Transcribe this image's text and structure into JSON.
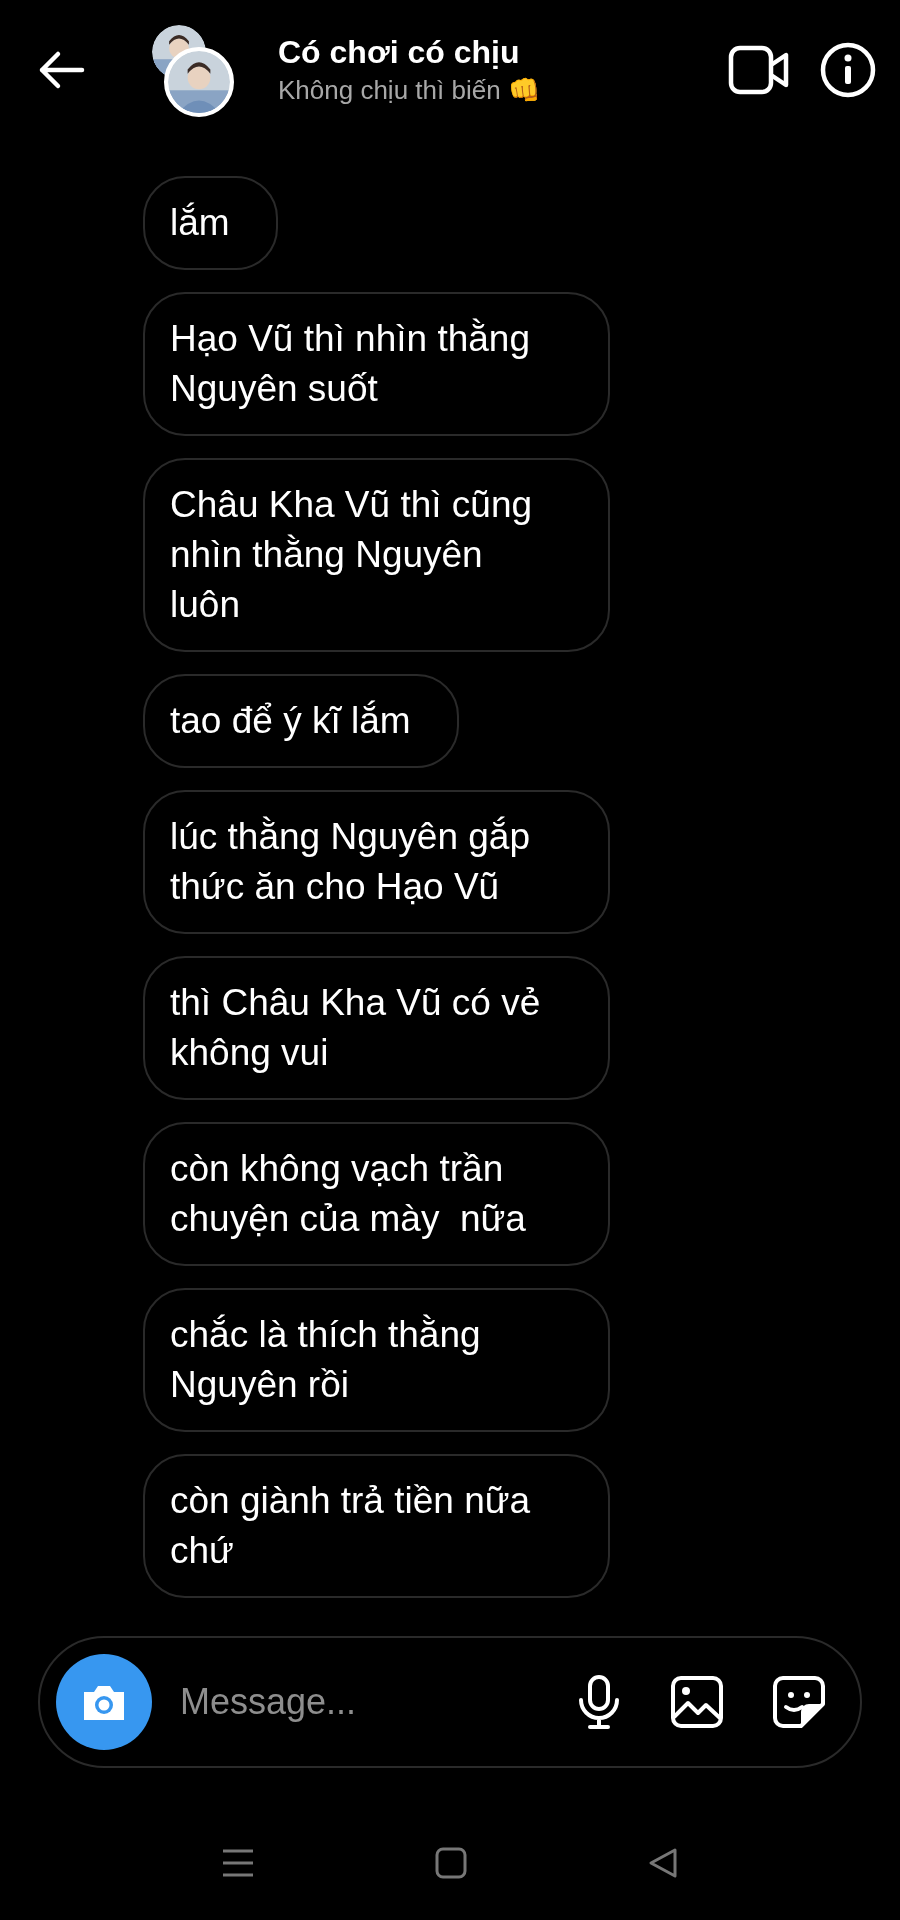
{
  "header": {
    "title": "Có chơi có chịu",
    "subtitle": "Không chịu thì biến 👊"
  },
  "messages": [
    {
      "text": "lắm"
    },
    {
      "text": "Hạo Vũ thì nhìn thằng Nguyên suốt"
    },
    {
      "text": "Châu Kha Vũ thì cũng nhìn thằng Nguyên luôn"
    },
    {
      "text": "tao để ý kĩ lắm"
    },
    {
      "text": "lúc thằng Nguyên gắp thức ăn cho Hạo Vũ"
    },
    {
      "text": "thì Châu Kha Vũ có vẻ không vui"
    },
    {
      "text": "còn không vạch trần chuyện của mày  nữa"
    },
    {
      "text": "chắc là thích thằng Nguyên rồi"
    },
    {
      "text": "còn giành trả tiền nữa chứ"
    }
  ],
  "composer": {
    "placeholder": "Message..."
  }
}
